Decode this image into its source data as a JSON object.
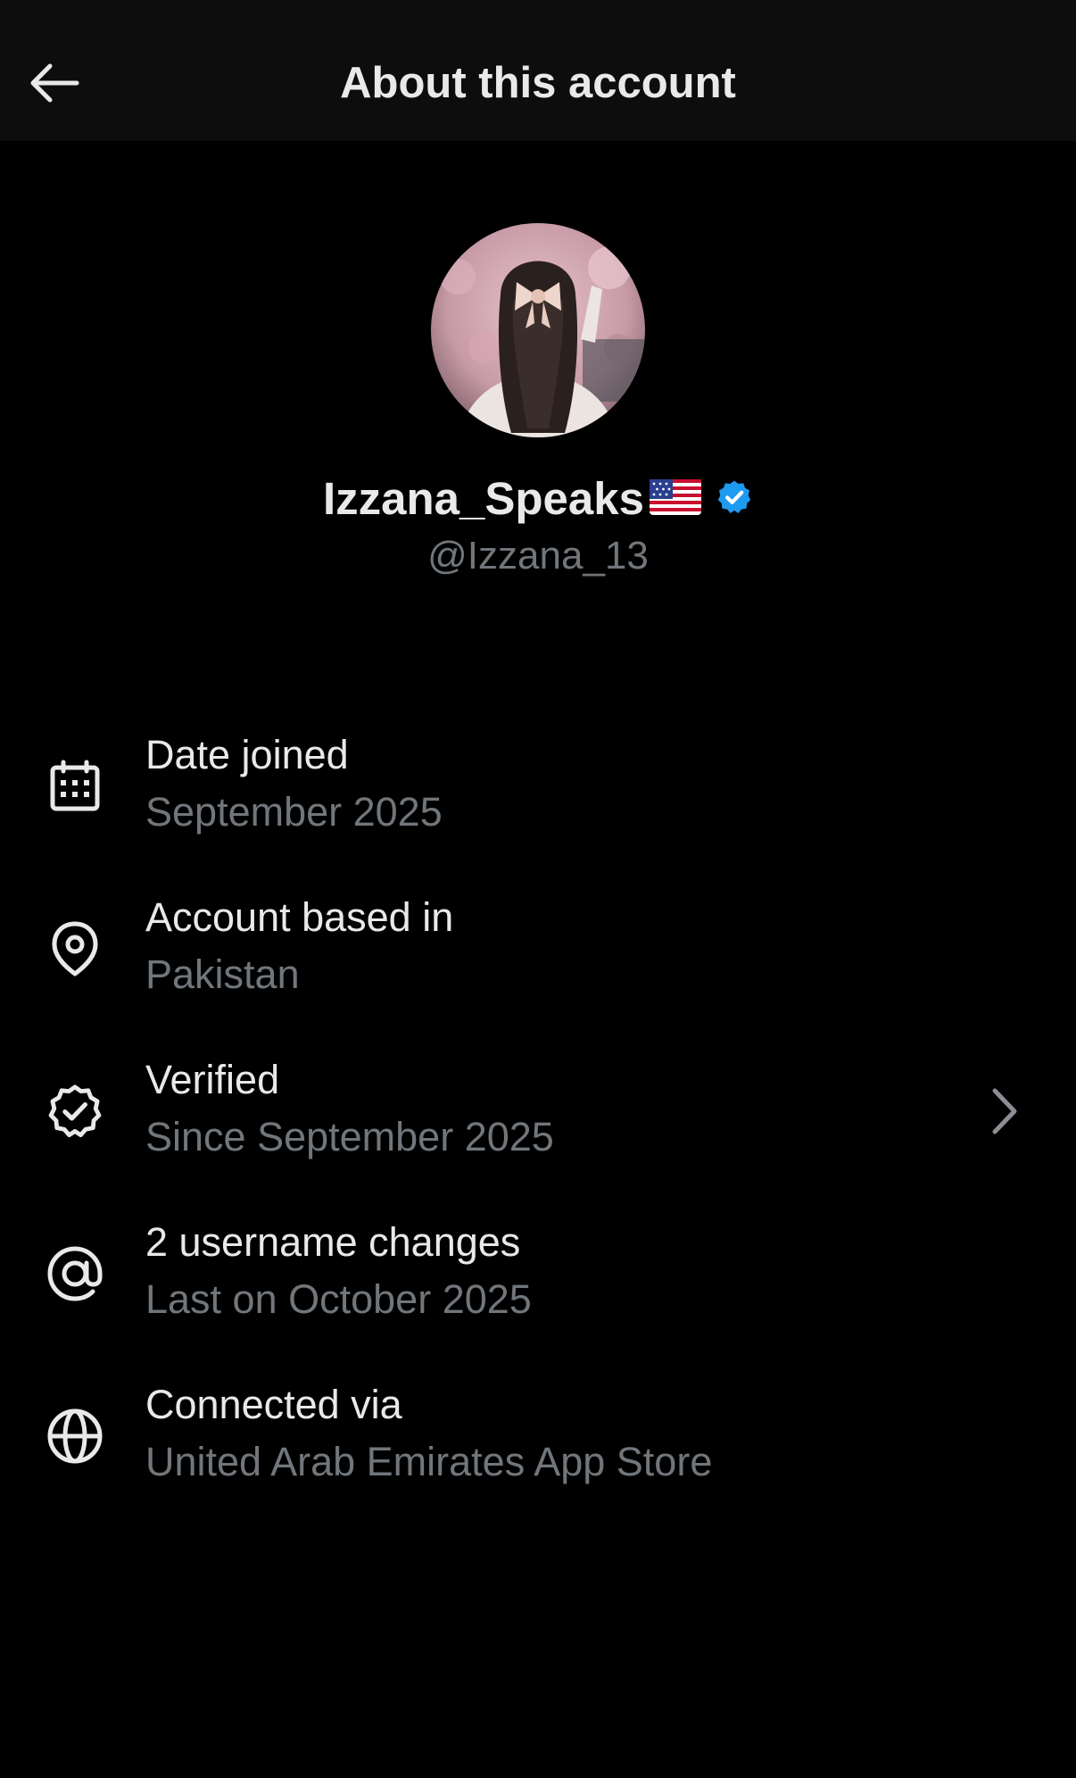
{
  "header": {
    "back_icon": "arrow-left-icon",
    "title": "About this account"
  },
  "profile": {
    "avatar_icon": "profile-photo",
    "name": "Izzana_Speaks",
    "flag_icon": "us-flag-icon",
    "verified_icon": "verified-badge-icon",
    "handle": "@Izzana_13",
    "badge_color": "#1d9bf0"
  },
  "details": [
    {
      "icon": "calendar-icon",
      "title": "Date joined",
      "subtitle": "September 2025"
    },
    {
      "icon": "location-pin-icon",
      "title": "Account based in",
      "subtitle": "Pakistan"
    },
    {
      "icon": "verified-check-icon",
      "title": "Verified",
      "subtitle": "Since September 2025",
      "chevron_icon": "chevron-right-icon"
    },
    {
      "icon": "at-sign-icon",
      "title": "2 username changes",
      "subtitle": "Last on October 2025"
    },
    {
      "icon": "globe-icon",
      "title": "Connected via",
      "subtitle": "United Arab Emirates App Store"
    }
  ],
  "colors": {
    "background": "#000000",
    "header_background": "#0d0d0d",
    "primary_text": "#e7e9ea",
    "secondary_text": "#71767b"
  }
}
